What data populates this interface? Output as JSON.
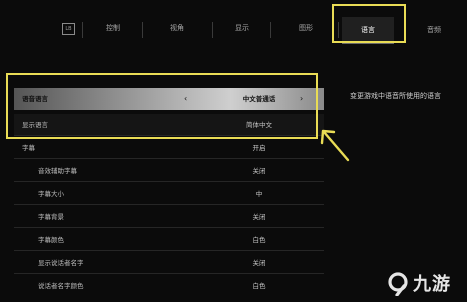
{
  "topbar": {
    "tab_icon_label": "LB",
    "tabs": [
      {
        "label": "控制"
      },
      {
        "label": "视角"
      },
      {
        "label": "显示"
      },
      {
        "label": "图形"
      },
      {
        "label": "语言"
      },
      {
        "label": "音频"
      }
    ],
    "active_tab": "语言"
  },
  "settings": {
    "rows": [
      {
        "label": "语音语言",
        "value": "中文普通话",
        "selected": true,
        "arrows": [
          "‹",
          "›"
        ]
      },
      {
        "label": "显示语言",
        "value": "简体中文"
      },
      {
        "label": "字幕",
        "value": "开启"
      },
      {
        "label": "音效辅助字幕",
        "value": "关闭"
      },
      {
        "label": "字幕大小",
        "value": "中"
      },
      {
        "label": "字幕背景",
        "value": "关闭"
      },
      {
        "label": "字幕颜色",
        "value": "白色"
      },
      {
        "label": "显示说话者名字",
        "value": "关闭"
      },
      {
        "label": "说话者名字颜色",
        "value": "白色"
      }
    ]
  },
  "description": "变更游戏中语音所使用的语言",
  "watermark": {
    "text": "九游"
  },
  "colors": {
    "highlight": "#e9dc55",
    "background": "#0b0b0b"
  }
}
